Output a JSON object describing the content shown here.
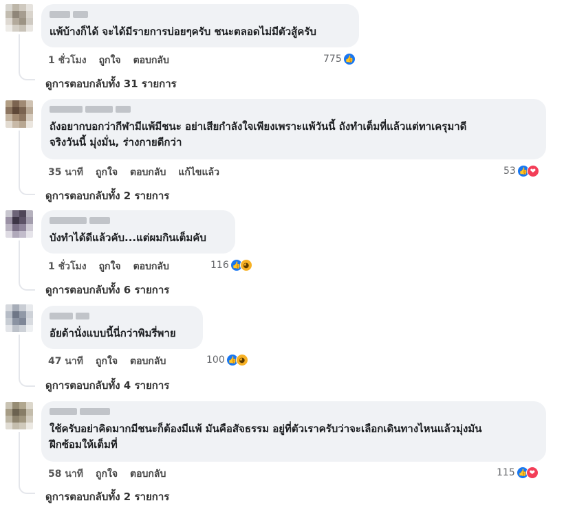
{
  "comments": [
    {
      "text_lines": [
        "แพ้บ้างก็ได้ จะได้มีรายการบ่อยๆครับ ชนะตลอดไม่มีตัวสู้ครับ"
      ],
      "time": "1 ชั่วโมง",
      "like_label": "ถูกใจ",
      "reply_label": "ตอบกลับ",
      "edited_label": "",
      "reaction_count": "775",
      "reactions": [
        "like-icon"
      ],
      "replies_text": "ดูการตอบกลับทั้ง 31 รายการ"
    },
    {
      "text_lines": [
        "ถังอยากบอกว่ากีฬามีแพ้มีชนะ อย่าเสียกำลังใจเพียงเพราะแพ้วันนี้ ถังทำเต็มที่แล้วแต่ทาเครุมาดี",
        "จริงวันนี้ มุ่งมั่น, ร่างกายดีกว่า"
      ],
      "time": "35 นาที",
      "like_label": "ถูกใจ",
      "reply_label": "ตอบกลับ",
      "edited_label": "แก้ไขแล้ว",
      "reaction_count": "53",
      "reactions": [
        "like-icon",
        "love-icon"
      ],
      "replies_text": "ดูการตอบกลับทั้ง 2 รายการ"
    },
    {
      "text_lines": [
        "บังทำได้ดีแล้วคับ...แต่ผมกินเต็มคับ"
      ],
      "time": "1 ชั่วโมง",
      "like_label": "ถูกใจ",
      "reply_label": "ตอบกลับ",
      "edited_label": "",
      "reaction_count": "116",
      "reactions": [
        "like-icon",
        "haha-icon"
      ],
      "replies_text": "ดูการตอบกลับทั้ง 6 รายการ"
    },
    {
      "text_lines": [
        "อัยด้านั่งแบบนี้นี่กว่าพิมรี่พาย"
      ],
      "time": "47 นาที",
      "like_label": "ถูกใจ",
      "reply_label": "ตอบกลับ",
      "edited_label": "",
      "reaction_count": "100",
      "reactions": [
        "like-icon",
        "haha-icon"
      ],
      "replies_text": "ดูการตอบกลับทั้ง 4 รายการ"
    },
    {
      "text_lines": [
        "ใช้ครับอย่าคิดมากมีชนะก็ต้องมีแพ้ มันคือสัจธรรม อยู่ที่ตัวเราครับว่าจะเลือกเดินทางไหนแล้วมุ่งมัน",
        "ฝึกซ้อมให้เต็มที่"
      ],
      "time": "58 นาที",
      "like_label": "ถูกใจ",
      "reply_label": "ตอบกลับ",
      "edited_label": "",
      "reaction_count": "115",
      "reactions": [
        "like-icon",
        "love-icon"
      ],
      "replies_text": "ดูการตอบกลับทั้ง 2 รายการ"
    }
  ],
  "colors": {
    "bubble": "#f0f2f5",
    "like": "#1877f2",
    "love": "#f33e58",
    "haha": "#f7b125",
    "thread_line": "#e4e6eb"
  }
}
